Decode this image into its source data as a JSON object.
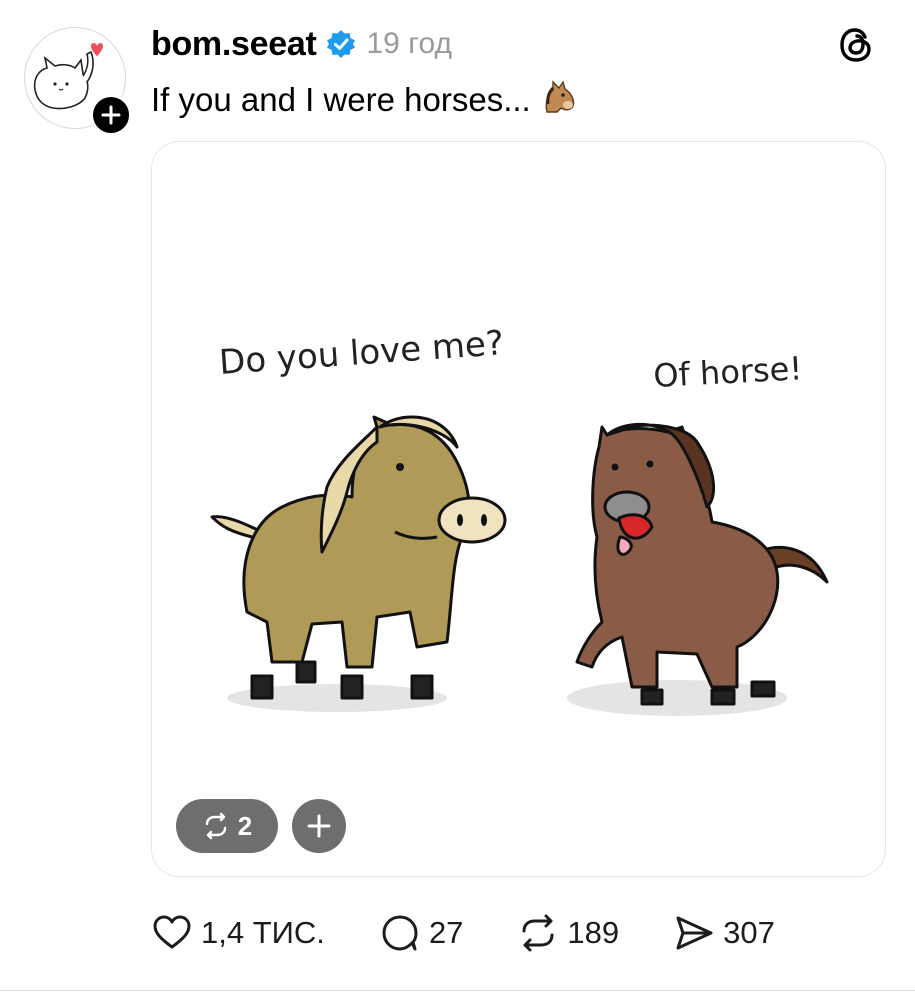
{
  "post": {
    "username": "bom.seeat",
    "timestamp": "19 год",
    "text": "If you and I were horses...",
    "text_emoji": "horse-face-emoji",
    "media": {
      "speech_left": "Do you love me?",
      "speech_right": "Of horse!",
      "repost_count": "2"
    },
    "actions": {
      "likes": "1,4 ТИС.",
      "comments": "27",
      "reposts": "189",
      "shares": "307"
    }
  },
  "icons": {
    "verified": "verified-badge-icon",
    "threads": "threads-logo-icon",
    "like": "heart-icon",
    "comment": "comment-bubble-icon",
    "repost": "repost-icon",
    "share": "send-icon"
  },
  "colors": {
    "verified_blue": "#1d9bf0",
    "timestamp_gray": "#9a9a9a",
    "pill_gray": "#6e6e6e",
    "horse_tan": "#b09a57",
    "horse_brown": "#8a5c47"
  }
}
